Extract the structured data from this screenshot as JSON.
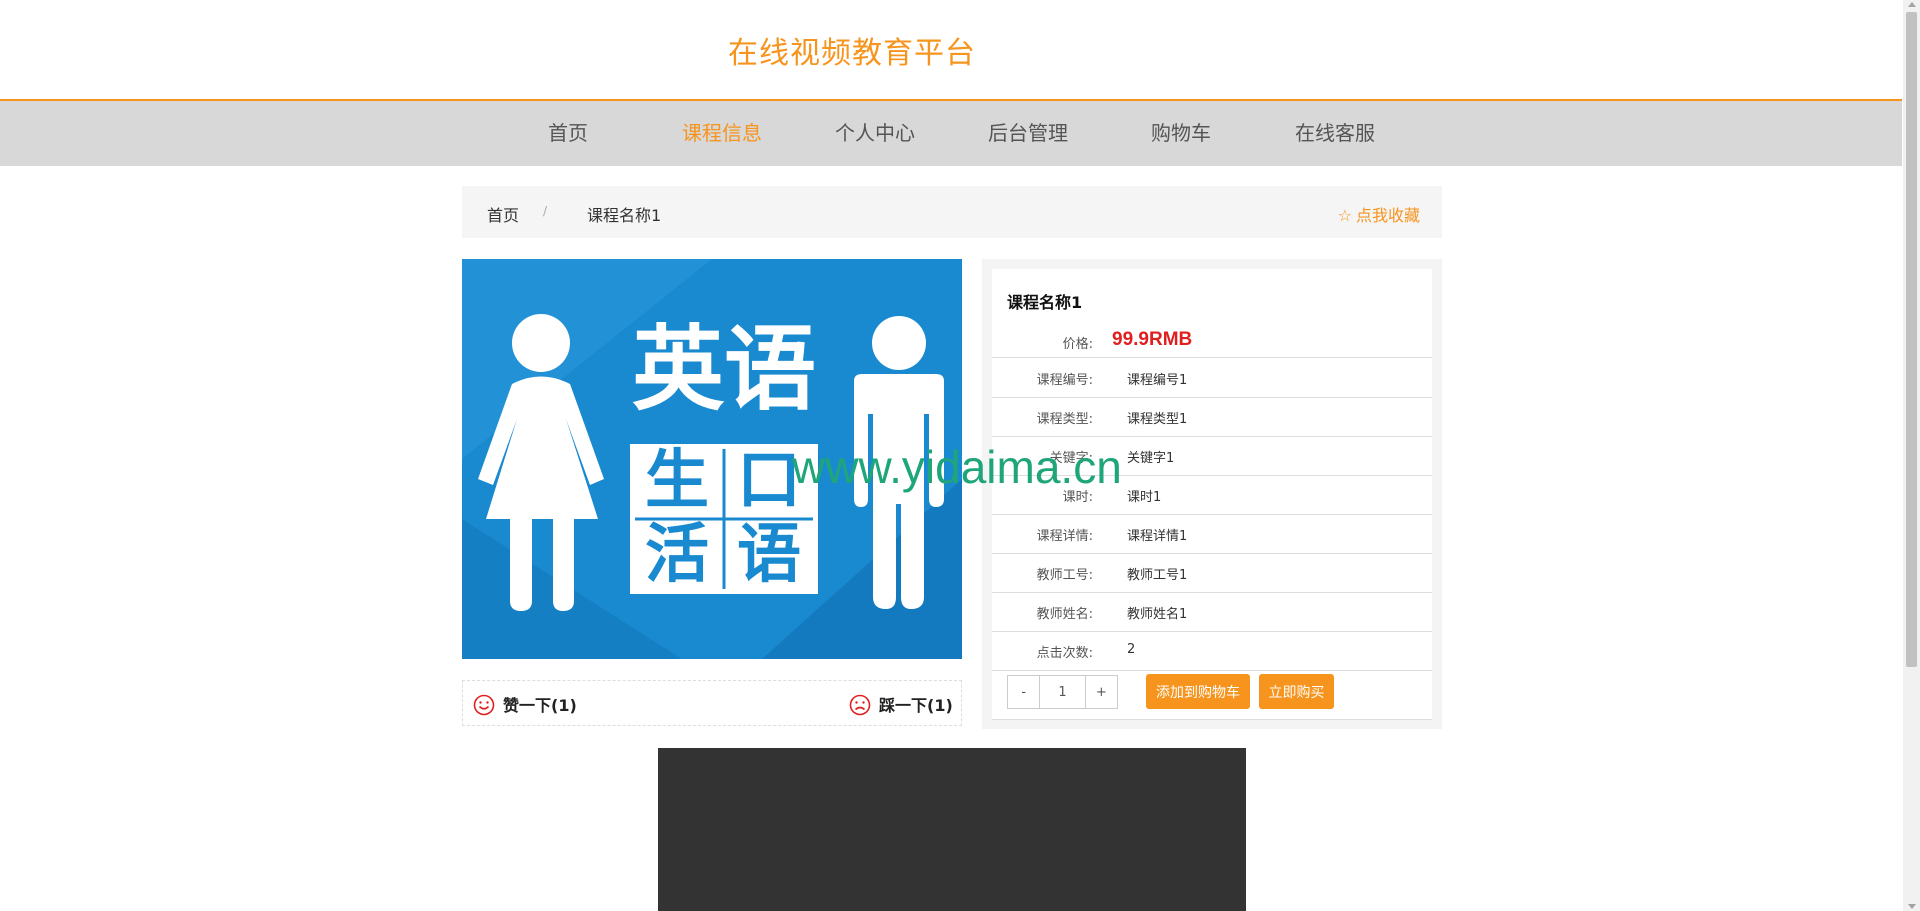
{
  "site": {
    "title": "在线视频教育平台"
  },
  "nav": {
    "items": [
      {
        "label": "首页"
      },
      {
        "label": "课程信息"
      },
      {
        "label": "个人中心"
      },
      {
        "label": "后台管理"
      },
      {
        "label": "购物车"
      },
      {
        "label": "在线客服"
      }
    ],
    "active": "课程信息"
  },
  "breadcrumb": {
    "home": "首页",
    "separator": "/",
    "current": "课程名称1",
    "favorite": "点我收藏"
  },
  "course": {
    "name": "课程名称1",
    "image_text": {
      "top": "英语",
      "grid": [
        "生",
        "口",
        "活",
        "语"
      ]
    },
    "price_label": "价格:",
    "price": "99.9RMB",
    "details": [
      {
        "label": "课程编号:",
        "value": "课程编号1"
      },
      {
        "label": "课程类型:",
        "value": "课程类型1"
      },
      {
        "label": "关键字:",
        "value": "关键字1"
      },
      {
        "label": "课时:",
        "value": "课时1"
      },
      {
        "label": "课程详情:",
        "value": "课程详情1"
      },
      {
        "label": "教师工号:",
        "value": "教师工号1"
      },
      {
        "label": "教师姓名:",
        "value": "教师姓名1"
      },
      {
        "label": "点击次数:",
        "value": "2"
      }
    ]
  },
  "votes": {
    "up_label": "赞一下(1)",
    "down_label": "踩一下(1)"
  },
  "cart": {
    "minus": "-",
    "quantity": "1",
    "plus": "+",
    "add_label": "添加到购物车",
    "buy_label": "立即购买"
  },
  "watermark": "www.yidaima.cn",
  "colors": {
    "accent": "#f7941d",
    "price": "#e02020",
    "nav_bg": "#d8d8d8",
    "image_bg": "#1a8ad0"
  }
}
